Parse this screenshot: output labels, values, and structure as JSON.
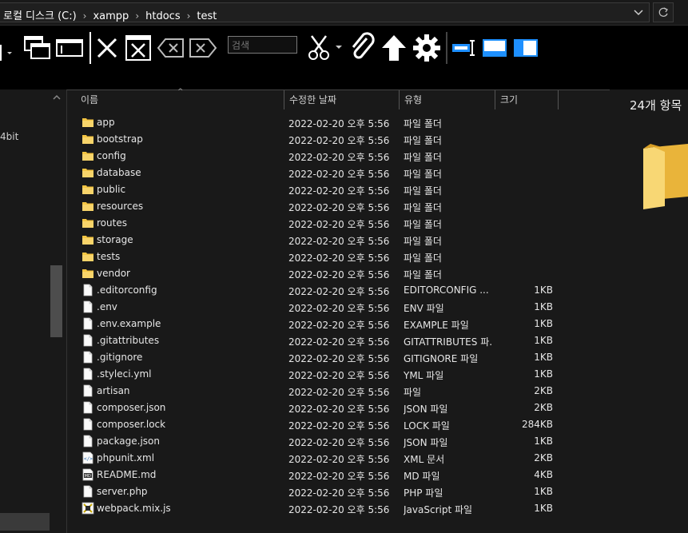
{
  "breadcrumb": [
    "로컬 디스크 (C:)",
    "xampp",
    "htdocs",
    "test"
  ],
  "search": {
    "placeholder": "검색"
  },
  "columns": {
    "name": "이름",
    "date": "수정한 날짜",
    "type": "유형",
    "size": "크기"
  },
  "left_pane_text": "4bit",
  "item_count": "24개 항목",
  "files": [
    {
      "name": "app",
      "date": "2022-02-20 오후 5:56",
      "type": "파일 폴더",
      "size": "",
      "icon": "folder-icon"
    },
    {
      "name": "bootstrap",
      "date": "2022-02-20 오후 5:56",
      "type": "파일 폴더",
      "size": "",
      "icon": "folder-icon"
    },
    {
      "name": "config",
      "date": "2022-02-20 오후 5:56",
      "type": "파일 폴더",
      "size": "",
      "icon": "folder-icon"
    },
    {
      "name": "database",
      "date": "2022-02-20 오후 5:56",
      "type": "파일 폴더",
      "size": "",
      "icon": "folder-icon"
    },
    {
      "name": "public",
      "date": "2022-02-20 오후 5:56",
      "type": "파일 폴더",
      "size": "",
      "icon": "folder-icon"
    },
    {
      "name": "resources",
      "date": "2022-02-20 오후 5:56",
      "type": "파일 폴더",
      "size": "",
      "icon": "folder-icon"
    },
    {
      "name": "routes",
      "date": "2022-02-20 오후 5:56",
      "type": "파일 폴더",
      "size": "",
      "icon": "folder-icon"
    },
    {
      "name": "storage",
      "date": "2022-02-20 오후 5:56",
      "type": "파일 폴더",
      "size": "",
      "icon": "folder-icon"
    },
    {
      "name": "tests",
      "date": "2022-02-20 오후 5:56",
      "type": "파일 폴더",
      "size": "",
      "icon": "folder-icon"
    },
    {
      "name": "vendor",
      "date": "2022-02-20 오후 5:56",
      "type": "파일 폴더",
      "size": "",
      "icon": "folder-icon"
    },
    {
      "name": ".editorconfig",
      "date": "2022-02-20 오후 5:56",
      "type": "EDITORCONFIG ...",
      "size": "1KB",
      "icon": "file-icon"
    },
    {
      "name": ".env",
      "date": "2022-02-20 오후 5:56",
      "type": "ENV 파일",
      "size": "1KB",
      "icon": "file-icon"
    },
    {
      "name": ".env.example",
      "date": "2022-02-20 오후 5:56",
      "type": "EXAMPLE 파일",
      "size": "1KB",
      "icon": "file-icon"
    },
    {
      "name": ".gitattributes",
      "date": "2022-02-20 오후 5:56",
      "type": "GITATTRIBUTES 파...",
      "size": "1KB",
      "icon": "file-icon"
    },
    {
      "name": ".gitignore",
      "date": "2022-02-20 오후 5:56",
      "type": "GITIGNORE 파일",
      "size": "1KB",
      "icon": "file-icon"
    },
    {
      "name": ".styleci.yml",
      "date": "2022-02-20 오후 5:56",
      "type": "YML 파일",
      "size": "1KB",
      "icon": "file-icon"
    },
    {
      "name": "artisan",
      "date": "2022-02-20 오후 5:56",
      "type": "파일",
      "size": "2KB",
      "icon": "file-icon"
    },
    {
      "name": "composer.json",
      "date": "2022-02-20 오후 5:56",
      "type": "JSON 파일",
      "size": "2KB",
      "icon": "file-icon"
    },
    {
      "name": "composer.lock",
      "date": "2022-02-20 오후 5:56",
      "type": "LOCK 파일",
      "size": "284KB",
      "icon": "file-icon"
    },
    {
      "name": "package.json",
      "date": "2022-02-20 오후 5:56",
      "type": "JSON 파일",
      "size": "1KB",
      "icon": "file-icon"
    },
    {
      "name": "phpunit.xml",
      "date": "2022-02-20 오후 5:56",
      "type": "XML 문서",
      "size": "2KB",
      "icon": "xml-file-icon"
    },
    {
      "name": "README.md",
      "date": "2022-02-20 오후 5:56",
      "type": "MD 파일",
      "size": "4KB",
      "icon": "md-file-icon"
    },
    {
      "name": "server.php",
      "date": "2022-02-20 오후 5:56",
      "type": "PHP 파일",
      "size": "1KB",
      "icon": "file-icon"
    },
    {
      "name": "webpack.mix.js",
      "date": "2022-02-20 오후 5:56",
      "type": "JavaScript 파일",
      "size": "1KB",
      "icon": "js-file-icon"
    }
  ],
  "toolbar_icons": [
    "pane-left-icon",
    "new-window-icon",
    "window-icon",
    "close-x-icon",
    "close-window-icon",
    "backspace-icon",
    "delete-icon",
    "scissors-icon",
    "paperclip-icon",
    "upload-arrow-icon",
    "gear-icon",
    "resize-icon",
    "layout-top-icon",
    "layout-split-icon"
  ],
  "colors": {
    "folder": "#f5c542",
    "background": "#191919",
    "toolbar": "#000000",
    "accent_blue": "#1e90ff"
  }
}
